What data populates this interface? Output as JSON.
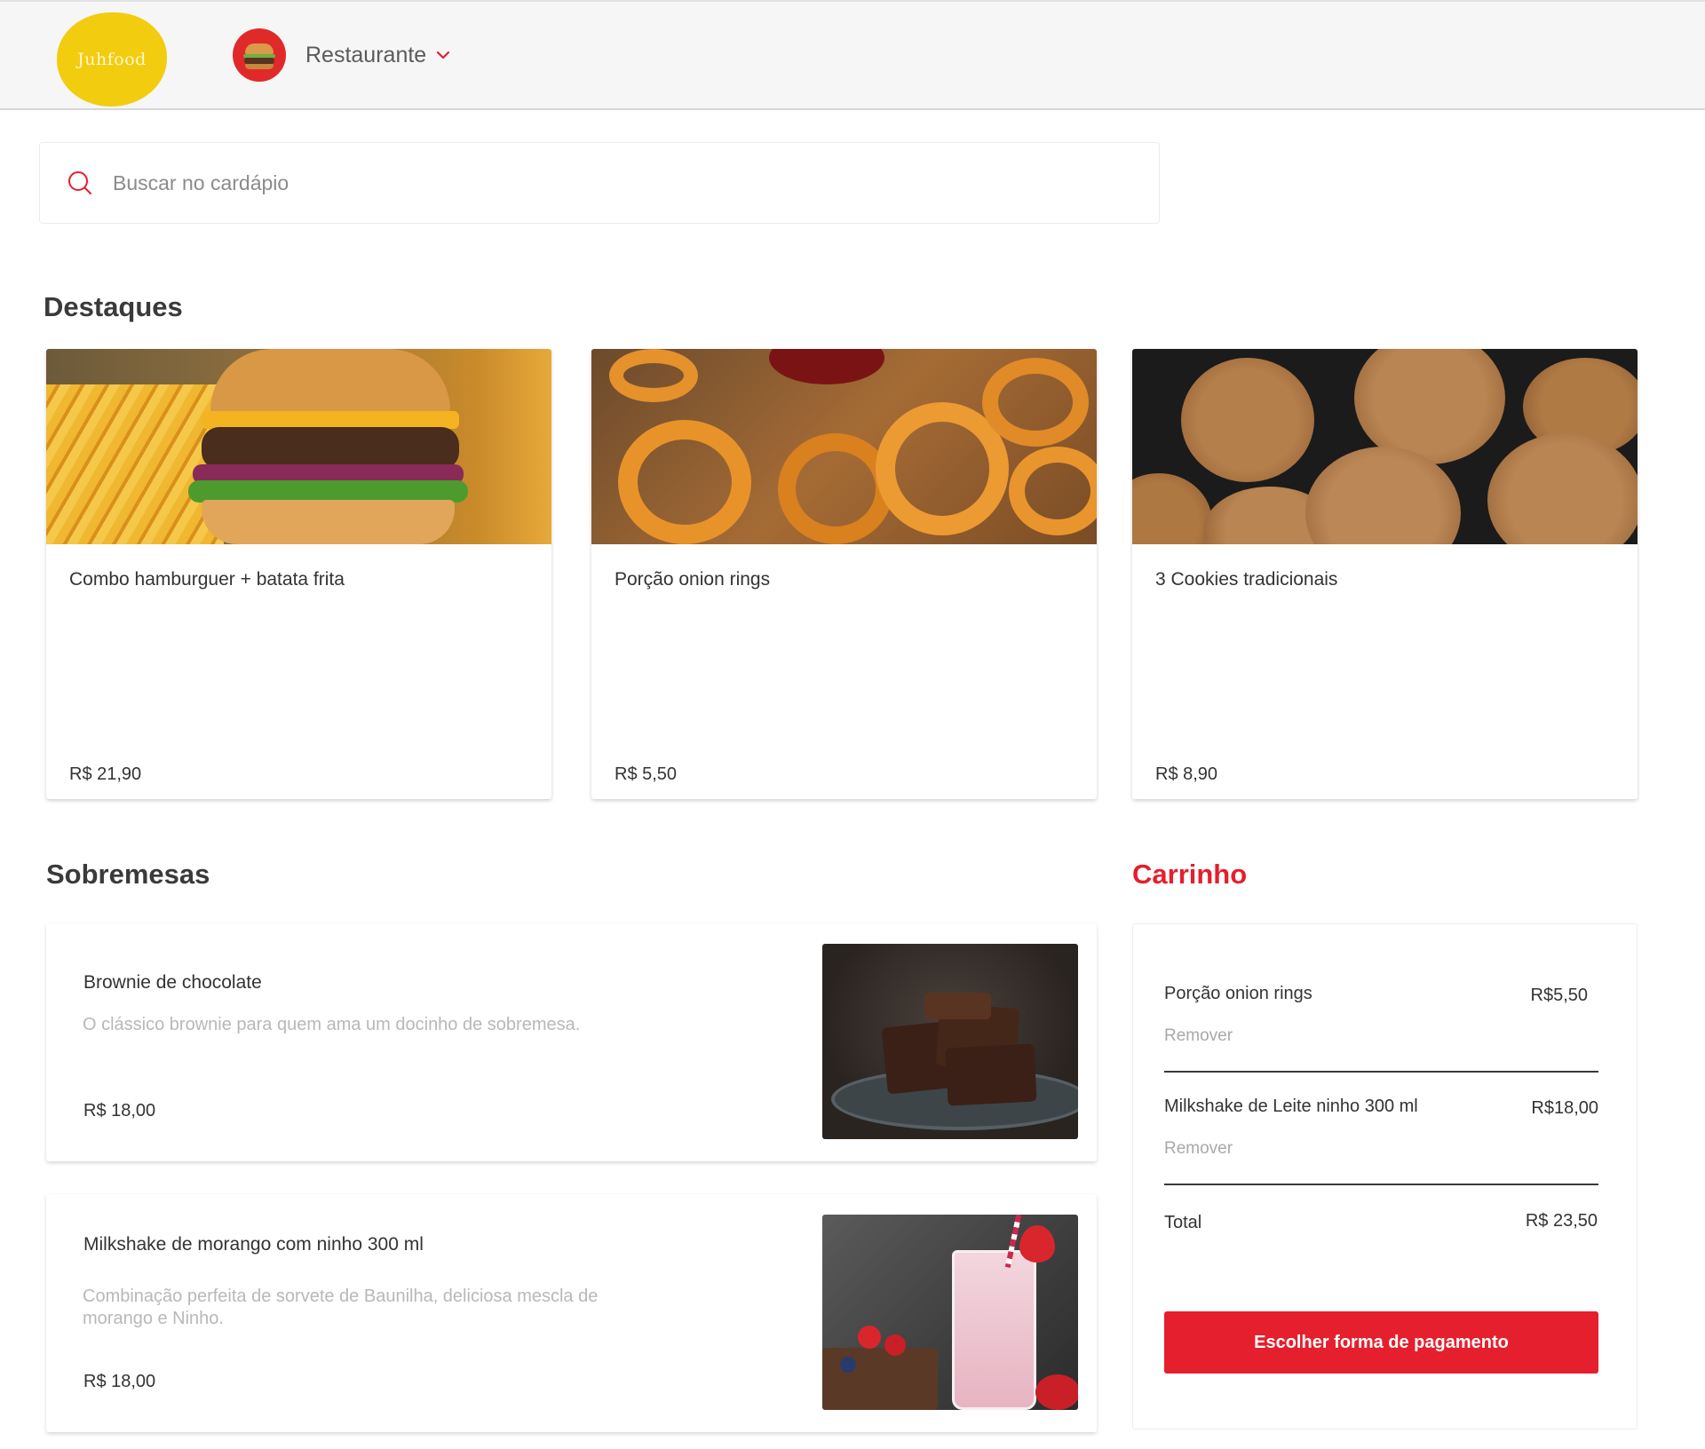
{
  "header": {
    "logo_text": "Juhfood",
    "restaurant_label": "Restaurante",
    "logo_color": "#f2cc0f"
  },
  "search": {
    "placeholder": "Buscar no cardápio",
    "value": ""
  },
  "featured": {
    "title": "Destaques",
    "items": [
      {
        "name": "Combo hamburguer + batata frita",
        "price": "R$ 21,90"
      },
      {
        "name": "Porção onion rings",
        "price": "R$ 5,50"
      },
      {
        "name": "3 Cookies tradicionais",
        "price": "R$ 8,90"
      }
    ]
  },
  "desserts": {
    "title": "Sobremesas",
    "items": [
      {
        "name": "Brownie de chocolate",
        "description": "O clássico brownie para quem ama um docinho de sobremesa.",
        "price": "R$ 18,00"
      },
      {
        "name": "Milkshake de morango com ninho 300 ml",
        "description": "Combinação perfeita de sorvete de Baunilha, deliciosa mescla de morango e Ninho.",
        "price": "R$ 18,00"
      }
    ]
  },
  "cart": {
    "title": "Carrinho",
    "items": [
      {
        "name": "Porção onion rings",
        "price": "R$5,50",
        "remove_label": "Remover"
      },
      {
        "name": "Milkshake de Leite ninho 300 ml",
        "price": "R$18,00",
        "remove_label": "Remover"
      }
    ],
    "total_label": "Total",
    "total_value": "R$ 23,50",
    "pay_button_label": "Escolher forma de pagamento"
  },
  "colors": {
    "accent": "#e51f2d",
    "text": "#333333",
    "muted": "#b8b8b8"
  },
  "icons": {
    "search": "search-icon",
    "chevron": "chevron-down-icon"
  }
}
